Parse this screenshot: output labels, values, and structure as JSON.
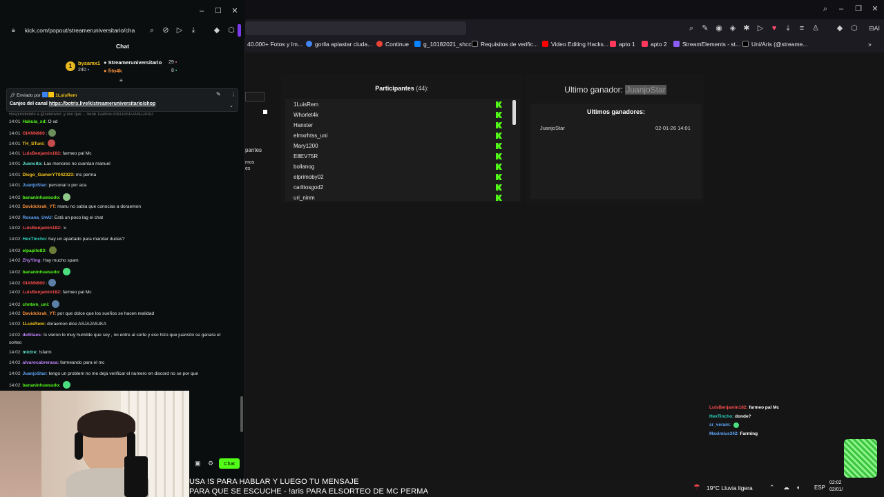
{
  "popout": {
    "url": "kick.com/popout/streameruniversitario/cha",
    "chat_title": "Chat",
    "leaders": [
      {
        "name": "bysamx1",
        "count": "240"
      },
      {
        "name": "Streameruniversitario",
        "count": "29"
      },
      {
        "name": "fito4k",
        "count": "8"
      }
    ],
    "pinned": {
      "sent_by": "Enviado por",
      "user": "1LuisRem",
      "text": "Canjes del canal",
      "link": "https://botrix.live/k/streameruniversitario/shop"
    },
    "reply_line": "Respondiendo a @celenvier: y eso que ... tiene 1vamos ASDJASDJASDJASD",
    "messages": [
      {
        "time": "14:01",
        "user": "Hakula_xd:",
        "color": "#53fc18",
        "text": "O xd"
      },
      {
        "time": "14:01",
        "user": "GIANN900",
        "color": "#ff4d4d",
        "text": ":",
        "emote": "#6b8e5a"
      },
      {
        "time": "14:01",
        "user": "TH_STuni:",
        "color": "#f5c518",
        "text": "",
        "emote": "#c24b4b"
      },
      {
        "time": "14:01",
        "user": "LuisBenjamin182:",
        "color": "#ff4d4d",
        "text": "farmeo pal Mc"
      },
      {
        "time": "14:01",
        "user": "Juxncito:",
        "color": "#5eead4",
        "text": "Las menores no cuentan manuel"
      },
      {
        "time": "14:01",
        "user": "Diego_GamerYT042323:",
        "color": "#f5c518",
        "text": "mc perma"
      },
      {
        "time": "14:01",
        "user": "JuanjoStar:",
        "color": "#60a5fa",
        "text": "personal o por aca"
      },
      {
        "time": "14:02",
        "user": "bananinhuesudo:",
        "color": "#53fc18",
        "text": "",
        "emote": "#8fc98a"
      },
      {
        "time": "14:02",
        "user": "Davidckrak_YT:",
        "color": "#fb923c",
        "text": "manu no sabia que conocias a doraemon"
      },
      {
        "time": "14:02",
        "user": "Roxana_UwU:",
        "color": "#60a5fa",
        "text": "Está un poco lag el chat"
      },
      {
        "time": "14:02",
        "user": "LuisBenjamin182:",
        "color": "#ff4d4d",
        "text": ":v"
      },
      {
        "time": "14:02",
        "user": "HexTincho:",
        "color": "#2dd4bf",
        "text": "hay un apartado para mandar dudas?"
      },
      {
        "time": "14:02",
        "user": "elpapito83:",
        "color": "#53fc18",
        "text": "",
        "emote": "#6b7d3a"
      },
      {
        "time": "14:02",
        "user": "ZhyYing:",
        "color": "#c084fc",
        "text": "Hay mucho spam"
      },
      {
        "time": "14:02",
        "user": "bananinhuesudo:",
        "color": "#53fc18",
        "text": "",
        "emote": "#4ade80"
      },
      {
        "time": "14:02",
        "user": "GIANN900",
        "color": "#ff4d4d",
        "text": ":",
        "emote": "#5b7fa6"
      },
      {
        "time": "14:02",
        "user": "LuisBenjamin182:",
        "color": "#ff4d4d",
        "text": "farmeo pal Mc"
      },
      {
        "time": "14:02",
        "user": "chntwn_uni:",
        "color": "#53fc18",
        "text": "",
        "emote": "#5b7fa6"
      },
      {
        "time": "14:02",
        "user": "Davidckrak_YT:",
        "color": "#fb923c",
        "text": "por que dolce que los sueños se hacen realidad"
      },
      {
        "time": "14:02",
        "user": "1LuisRem:",
        "color": "#f5c518",
        "text": "doraemon dice ASJAJASJKA"
      },
      {
        "time": "14:02",
        "user": "dellitaes:",
        "color": "#c084fc",
        "text": "Is vieron lo muy humilde que soy , no entre al sorte y eso hizo que juansito se ganara el"
      },
      {
        "time": "",
        "user": "",
        "color": "#fff",
        "text": "sorteo"
      },
      {
        "time": "14:02",
        "user": "mictre:",
        "color": "#5eead4",
        "text": "!sfarm"
      },
      {
        "time": "14:02",
        "user": "alvarocabrerasa:",
        "color": "#c084fc",
        "text": "farmeando para el mc"
      },
      {
        "time": "14:02",
        "user": "JuanjoStar:",
        "color": "#60a5fa",
        "text": "tengo un problem no me deja verificar el numero en discord no se por que"
      },
      {
        "time": "14:02",
        "user": "bananinhuesudo:",
        "color": "#53fc18",
        "text": "",
        "emote": "#4ade80"
      }
    ],
    "chat_button": "Chat"
  },
  "bookmarks": [
    "40.000+ Fotos y Im...",
    "gorila aplastar ciuda...",
    "Continue",
    "g_10182021_shcc",
    "Requisitos de verific...",
    "Video Editing Hacks...",
    "apto 1",
    "apto 2",
    "StreamElements - st...",
    "Uni/Aris (@streame..."
  ],
  "left_partial": [
    "pantes",
    "mos",
    "es"
  ],
  "participants": {
    "title": "Participantes",
    "count": "(44):",
    "names": [
      "1LuisRem",
      "Whorlet4k",
      "Hanxter",
      "elmxrhtss_uni",
      "Mary1200",
      "E8EV75R",
      "bollanog",
      "elprimoby02",
      "carlitosgod2",
      "uri_ninm"
    ]
  },
  "winner": {
    "label": "Ultimo ganador:",
    "name": "JuanjoStar",
    "recent_title": "Ultimos ganadores:",
    "recent": [
      {
        "name": "JuanjoStar",
        "date": "02-01-26 14:01"
      }
    ]
  },
  "overlay_chat": [
    {
      "user": "LuisBenjamin182:",
      "color": "#ff4d4d",
      "text": "farmeo pal Mc"
    },
    {
      "user": "HexTincho:",
      "color": "#2dd4bf",
      "text": "donde?"
    },
    {
      "user": "sr_veram:",
      "color": "#60a5fa",
      "text": ""
    },
    {
      "user": "Maximius342:",
      "color": "#60a5fa",
      "text": "Farming"
    }
  ],
  "subtitle": {
    "line1": "USA !S PARA HABLAR Y LUEGO TU MENSAJE",
    "line2": "PARA QUE SE ESCUCHE - !aris PARA ELSORTEO DE MC PERMA"
  },
  "taskbar": {
    "weather": "19°C  Lluvia ligera",
    "lang": "ESP",
    "time": "02:02",
    "date": "02/01/"
  }
}
